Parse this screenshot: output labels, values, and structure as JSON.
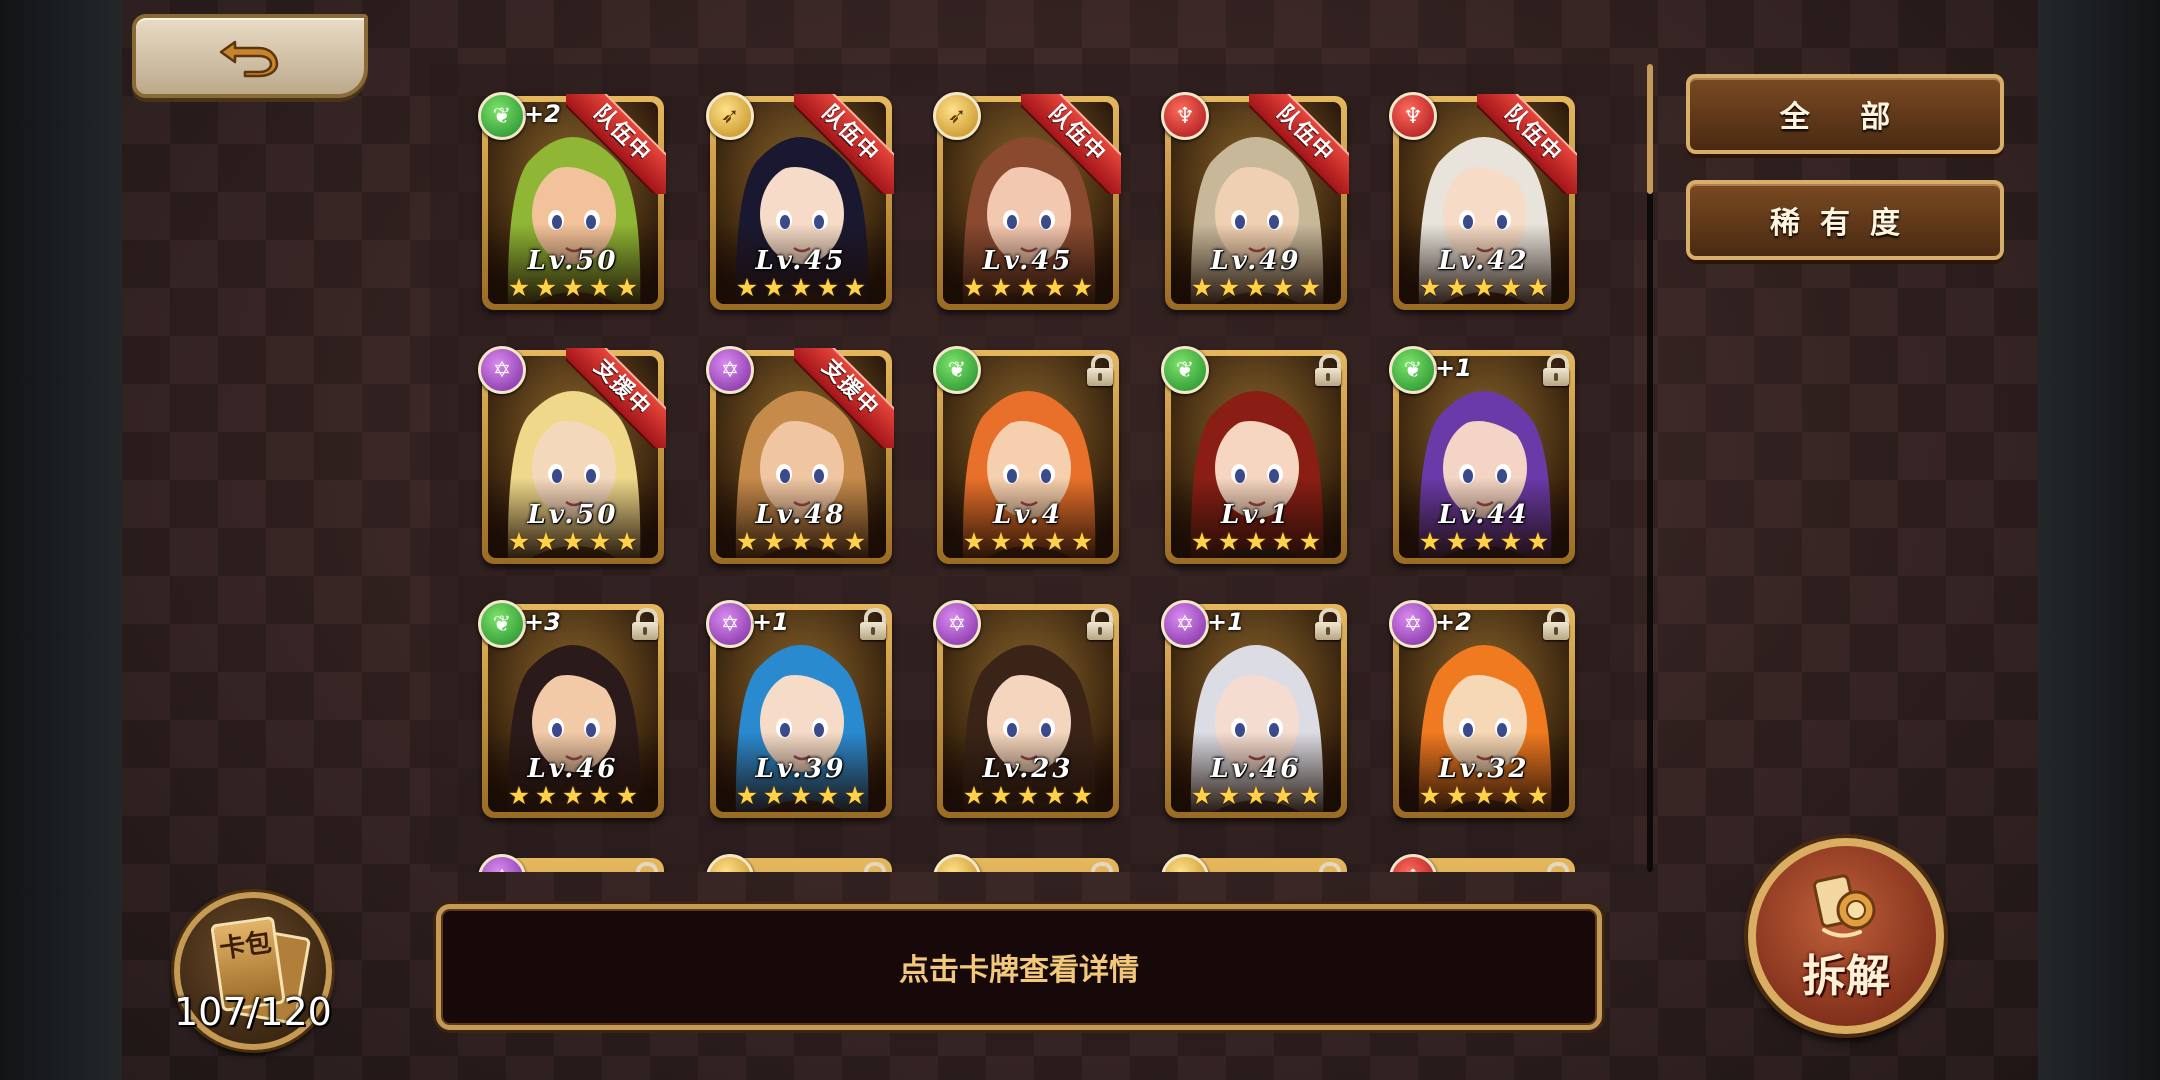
{
  "back": {
    "icon": "back-arrow-icon"
  },
  "filters": {
    "all_label": "全 部",
    "rarity_label": "稀有度"
  },
  "info_text": "点击卡牌查看详情",
  "pack": {
    "label": "卡包",
    "count": "107/120"
  },
  "dismantle_label": "拆解",
  "colors": {
    "ribbon": "#c51f24",
    "gold": "#c49a55",
    "star": "#ffd24a"
  },
  "cards": [
    {
      "attr": "nature",
      "attr_icon": "nature-attribute-icon",
      "plus": "+2",
      "status": "队伍中",
      "locked": false,
      "level": "Lv.50",
      "stars": 5,
      "hair": "#8fb634",
      "skin": "#f2c39a",
      "bg": "#5a3a12"
    },
    {
      "attr": "bow",
      "attr_icon": "bow-attribute-icon",
      "plus": "",
      "status": "队伍中",
      "locked": false,
      "level": "Lv.45",
      "stars": 5,
      "hair": "#1a1830",
      "skin": "#f6dcc8",
      "bg": "#3a2a20"
    },
    {
      "attr": "bow",
      "attr_icon": "bow-attribute-icon",
      "plus": "",
      "status": "队伍中",
      "locked": false,
      "level": "Lv.45",
      "stars": 5,
      "hair": "#8a4a30",
      "skin": "#f3c8b0",
      "bg": "#6a3a22"
    },
    {
      "attr": "fire",
      "attr_icon": "fire-attribute-icon",
      "plus": "",
      "status": "队伍中",
      "locked": false,
      "level": "Lv.49",
      "stars": 5,
      "hair": "#c8b89a",
      "skin": "#f0d0b2",
      "bg": "#6a4a30"
    },
    {
      "attr": "fire",
      "attr_icon": "fire-attribute-icon",
      "plus": "",
      "status": "队伍中",
      "locked": false,
      "level": "Lv.42",
      "stars": 5,
      "hair": "#e8e4dc",
      "skin": "#f6dcc6",
      "bg": "#5a3012"
    },
    {
      "attr": "magic",
      "attr_icon": "magic-attribute-icon",
      "plus": "",
      "status": "支援中",
      "locked": false,
      "level": "Lv.50",
      "stars": 5,
      "hair": "#efd88a",
      "skin": "#f4d8bc",
      "bg": "#6a4a20"
    },
    {
      "attr": "magic",
      "attr_icon": "magic-attribute-icon",
      "plus": "",
      "status": "支援中",
      "locked": false,
      "level": "Lv.48",
      "stars": 5,
      "hair": "#c68a4a",
      "skin": "#f0c6a2",
      "bg": "#6a3a1a"
    },
    {
      "attr": "nature",
      "attr_icon": "nature-attribute-icon",
      "plus": "",
      "status": "",
      "locked": true,
      "level": "Lv.4",
      "stars": 5,
      "hair": "#e8702a",
      "skin": "#f6d0ae",
      "bg": "#5a2a1a"
    },
    {
      "attr": "nature",
      "attr_icon": "nature-attribute-icon",
      "plus": "",
      "status": "",
      "locked": true,
      "level": "Lv.1",
      "stars": 5,
      "hair": "#8a1e14",
      "skin": "#f6d6c0",
      "bg": "#3a2a2a"
    },
    {
      "attr": "nature",
      "attr_icon": "nature-attribute-icon",
      "plus": "+1",
      "status": "",
      "locked": true,
      "level": "Lv.44",
      "stars": 5,
      "hair": "#6a3aa8",
      "skin": "#f4d4c4",
      "bg": "#2a1a3a"
    },
    {
      "attr": "nature",
      "attr_icon": "nature-attribute-icon",
      "plus": "+3",
      "status": "",
      "locked": true,
      "level": "Lv.46",
      "stars": 5,
      "hair": "#2a1a1a",
      "skin": "#f2caa8",
      "bg": "#5a3018"
    },
    {
      "attr": "magic",
      "attr_icon": "magic-attribute-icon",
      "plus": "+1",
      "status": "",
      "locked": true,
      "level": "Lv.39",
      "stars": 5,
      "hair": "#2a8ad0",
      "skin": "#f6dcc8",
      "bg": "#3a2a1a"
    },
    {
      "attr": "magic",
      "attr_icon": "magic-attribute-icon",
      "plus": "",
      "status": "",
      "locked": true,
      "level": "Lv.23",
      "stars": 5,
      "hair": "#3a2418",
      "skin": "#f4d6be",
      "bg": "#4a3a2a"
    },
    {
      "attr": "magic",
      "attr_icon": "magic-attribute-icon",
      "plus": "+1",
      "status": "",
      "locked": true,
      "level": "Lv.46",
      "stars": 5,
      "hair": "#dcdce4",
      "skin": "#f4dcd0",
      "bg": "#4a4a5a"
    },
    {
      "attr": "magic",
      "attr_icon": "magic-attribute-icon",
      "plus": "+2",
      "status": "",
      "locked": true,
      "level": "Lv.32",
      "stars": 5,
      "hair": "#f07a20",
      "skin": "#f6d8b6",
      "bg": "#5a2a10"
    }
  ],
  "partial_row": [
    {
      "attr": "magic"
    },
    {
      "attr": "bow"
    },
    {
      "attr": "bow"
    },
    {
      "attr": "bow"
    },
    {
      "attr": "fire"
    }
  ]
}
